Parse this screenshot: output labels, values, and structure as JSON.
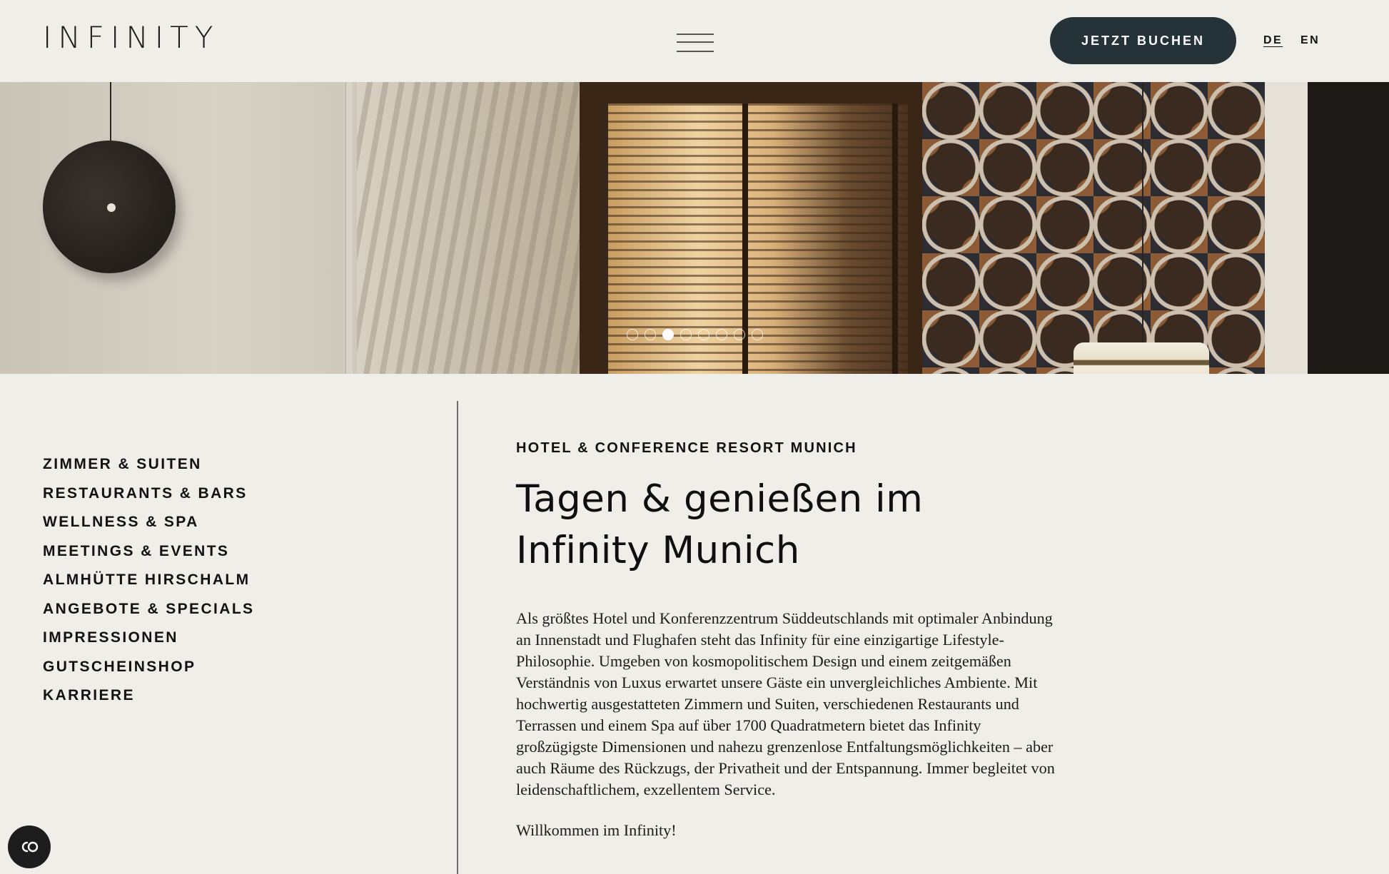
{
  "header": {
    "logo": "INFINITY",
    "menu_icon": "hamburger-menu-icon",
    "book_label": "JETZT BUCHEN",
    "languages": [
      {
        "code": "DE",
        "active": true
      },
      {
        "code": "EN",
        "active": false
      }
    ],
    "book_button_color": "#253238"
  },
  "hero": {
    "slide_count": 8,
    "active_slide": 3
  },
  "sidebar": {
    "items": [
      {
        "label": "ZIMMER & SUITEN"
      },
      {
        "label": "RESTAURANTS & BARS"
      },
      {
        "label": "WELLNESS & SPA"
      },
      {
        "label": "MEETINGS & EVENTS"
      },
      {
        "label": "ALMHÜTTE HIRSCHALM"
      },
      {
        "label": "ANGEBOTE & SPECIALS"
      },
      {
        "label": "IMPRESSIONEN"
      },
      {
        "label": "GUTSCHEINSHOP"
      },
      {
        "label": "KARRIERE"
      }
    ]
  },
  "main": {
    "eyebrow": "HOTEL & CONFERENCE RESORT MUNICH",
    "headline_line1": "Tagen & genießen im",
    "headline_line2": "Infinity Munich",
    "body_lines": [
      "Als größtes Hotel und Konferenzzentrum Süddeutschlands mit optimaler Anbindung",
      "an Innenstadt und Flughafen steht das Infinity für eine einzigartige Lifestyle-",
      "Philosophie. Umgeben von kosmopolitischem Design und einem zeitgemäßen",
      "Verständnis von Luxus erwartet unsere Gäste ein unvergleichliches Ambiente. Mit",
      "hochwertig ausgestatteten Zimmern und Suiten, verschiedenen Restaurants und",
      "Terrassen und einem Spa auf über 1700 Quadratmetern bietet das Infinity",
      "großzügigste Dimensionen und nahezu grenzenlose Entfaltungsmöglichkeiten – aber",
      "auch Räume des Rückzugs, der Privatheit und der Entspannung. Immer begleitet von",
      "leidenschaftlichem, exzellentem Service."
    ],
    "welcome": "Willkommen im Infinity!"
  },
  "cookie": {
    "icon": "cookie-consent-icon"
  },
  "colors": {
    "background": "#efeee9",
    "text": "#111111",
    "accent": "#253238"
  }
}
